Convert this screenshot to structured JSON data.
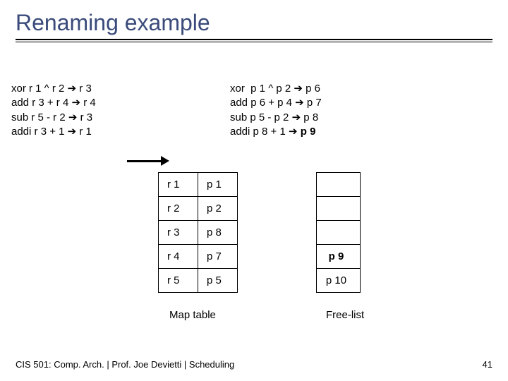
{
  "title": "Renaming example",
  "left": {
    "l1a": "xor r 1 ^ r 2 ",
    "l1b": " r 3",
    "l2a": "add r 3 + r 4 ",
    "l2b": " r 4",
    "l3a": "sub r 5 - r 2 ",
    "l3b": " r 3",
    "l4a": "addi r 3 + 1 ",
    "l4b": " r 1"
  },
  "right": {
    "l1a": "xor  p 1 ^ p 2 ",
    "l1b": " p 6",
    "l2a": "add p 6 + p 4 ",
    "l2b": " p 7",
    "l3a": "sub p 5 - p 2 ",
    "l3b": " p 8",
    "l4a": "addi p 8 + 1 ",
    "l4b": " ",
    "l4c": "p 9"
  },
  "map": {
    "caption": "Map table",
    "rows": [
      {
        "r": "r 1",
        "p": "p 1"
      },
      {
        "r": "r 2",
        "p": "p 2"
      },
      {
        "r": "r 3",
        "p": "p 8"
      },
      {
        "r": "r 4",
        "p": "p 7"
      },
      {
        "r": "r 5",
        "p": "p 5"
      }
    ]
  },
  "free": {
    "caption": "Free-list",
    "rows": [
      {
        "v": "",
        "bold": false
      },
      {
        "v": "",
        "bold": false
      },
      {
        "v": "",
        "bold": false
      },
      {
        "v": "p 9",
        "bold": true
      },
      {
        "v": "p 10",
        "bold": false
      }
    ]
  },
  "footer": {
    "left": "CIS 501: Comp. Arch.  |  Prof. Joe Devietti  |  Scheduling",
    "right": "41"
  },
  "glyph": {
    "arrow": "➔"
  }
}
